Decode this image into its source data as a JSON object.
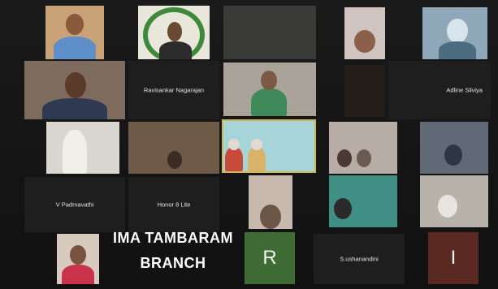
{
  "participants": {
    "ravisankar": "Ravisankar Nagarajan",
    "adline": "Adline Silviya",
    "padmavathi": "V Padmavathi",
    "honor": "Honor 8 Lite",
    "ushanandini": "S.ushanandini",
    "letter_r": "R",
    "letter_i": "I"
  },
  "caption": {
    "line1": "IMA TAMBARAM",
    "line2": "BRANCH"
  },
  "colors": {
    "tile_r": "#3f6b35",
    "tile_i": "#5a2a22",
    "caption_text": "#ffffff",
    "active_speaker_border": "#d4b84a"
  }
}
